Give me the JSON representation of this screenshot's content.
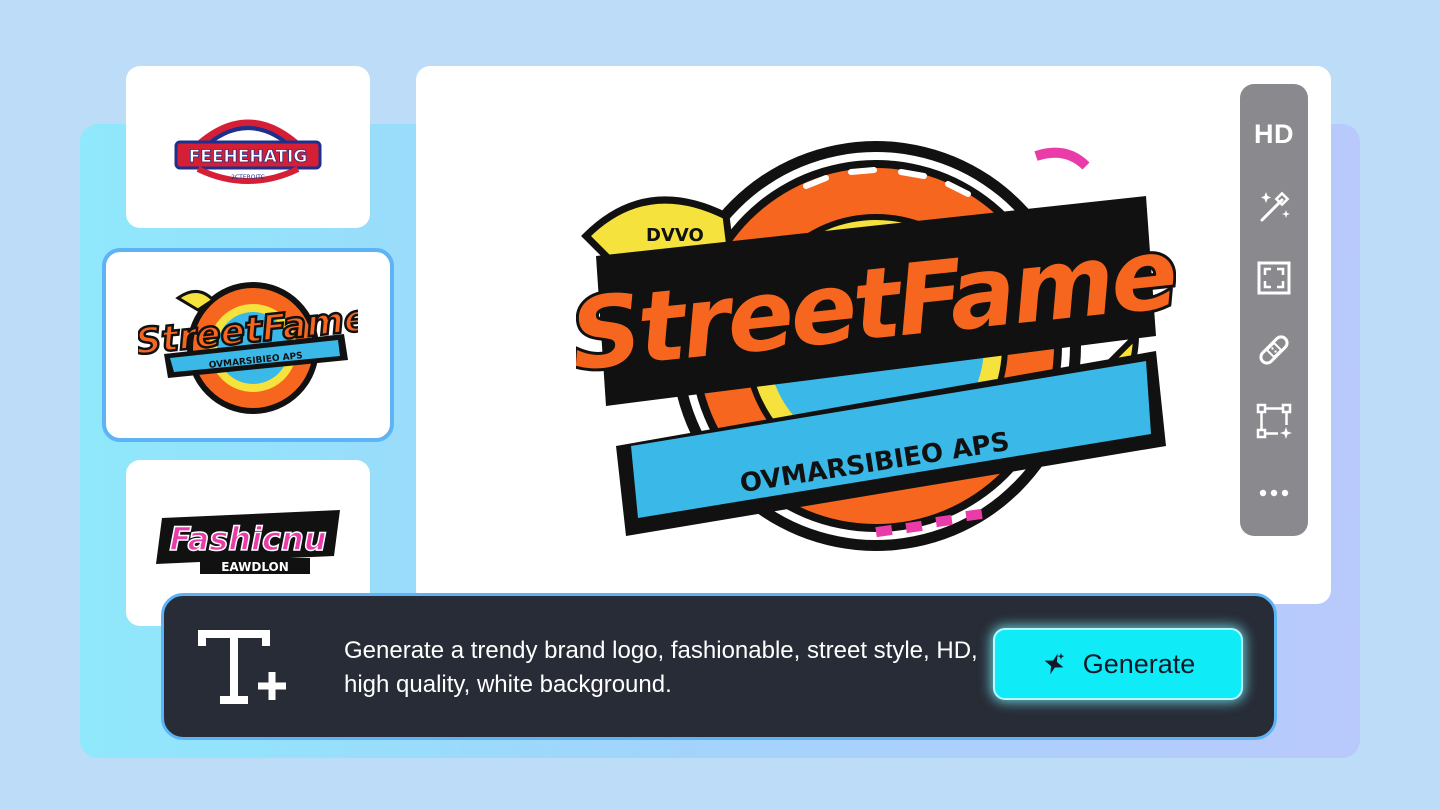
{
  "thumbnails": [
    {
      "logo_text": "FEEHEHATIG",
      "sub_text": "2CTEROITC"
    },
    {
      "logo_text": "StreetFame",
      "sub_text": "OVMARSIBIEO APS"
    },
    {
      "logo_text": "Fashicnu",
      "sub_text": "EAWDLON"
    }
  ],
  "canvas": {
    "logo_text": "StreetFame",
    "sub_text": "OVMARSIBIEO APS",
    "small_text": "DVVO"
  },
  "toolbar": {
    "hd_label": "HD",
    "tools": [
      "magic-wand-icon",
      "expand-icon",
      "bandage-icon",
      "transform-icon",
      "more-icon"
    ]
  },
  "prompt": {
    "text": "Generate a trendy brand logo, fashionable, street style, HD, high quality, white background."
  },
  "generate_button": {
    "label": "Generate"
  },
  "colors": {
    "accent": "#10ecf7",
    "prompt_bg": "#272c36",
    "selection_border": "#5db3f6",
    "logo_orange": "#f6661e",
    "logo_blue": "#3ab9e8",
    "logo_yellow": "#f6e23c",
    "logo_pink": "#e93ca8"
  }
}
